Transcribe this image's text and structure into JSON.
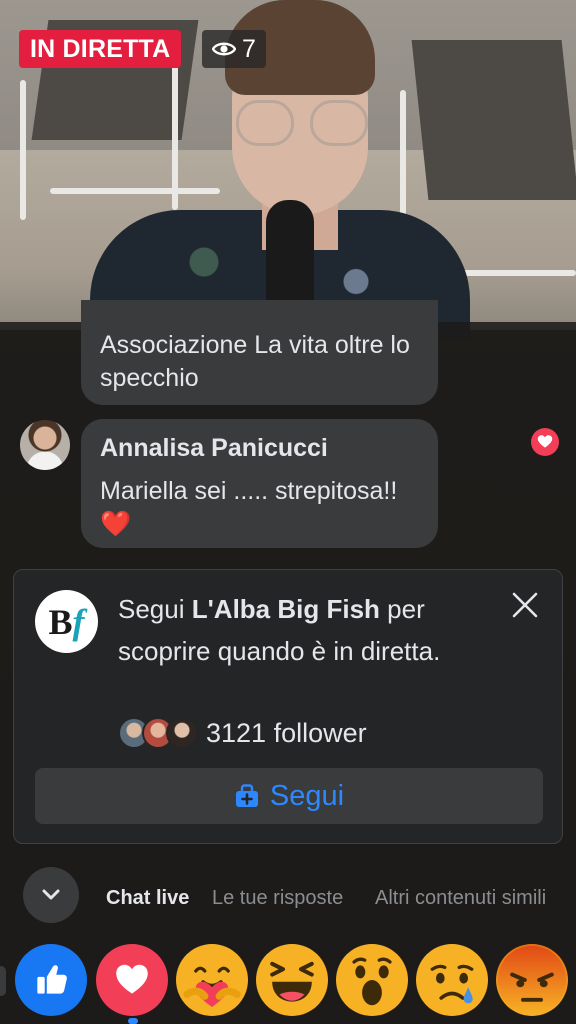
{
  "live": {
    "badge": "IN DIRETTA",
    "viewer_count": "7"
  },
  "chat": {
    "messages": [
      {
        "author": "",
        "text": "Associazione La vita oltre lo specchio"
      },
      {
        "author": "Annalisa Panicucci",
        "text": "Mariella sei ..... strepitosa!!❤️",
        "liked": true
      }
    ]
  },
  "follow_card": {
    "prefix": "Segui ",
    "page_name": "L'Alba Big Fish",
    "suffix": " per scoprire quando è in diretta.",
    "follower_count": "3121 follower",
    "follow_button": "Segui",
    "logo_letters": {
      "b": "B",
      "f": "f"
    }
  },
  "tabs": [
    "Chat live",
    "Le tue risposte",
    "Altri contenuti simili"
  ],
  "reactions": [
    "like-icon",
    "love-icon",
    "care-icon",
    "haha-icon",
    "wow-icon",
    "sad-icon",
    "angry-icon"
  ],
  "colors": {
    "live_red": "#e41e3f",
    "accent_blue": "#2d88ff",
    "bubble": "#3a3b3c",
    "card": "#242526"
  }
}
